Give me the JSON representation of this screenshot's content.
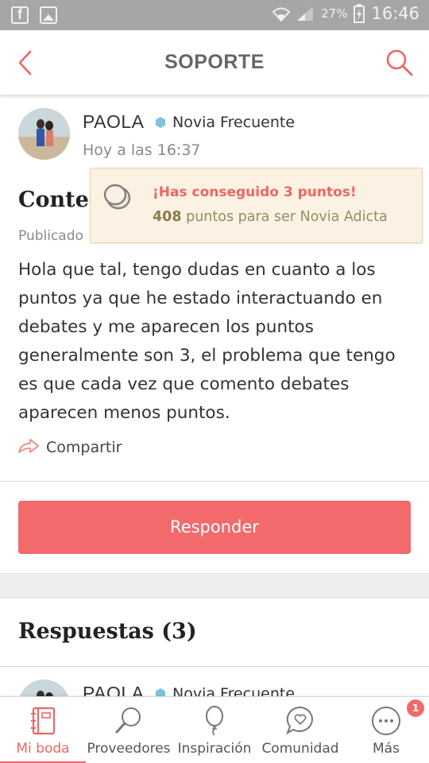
{
  "status_bar": {
    "battery": "27%",
    "time": "16:46"
  },
  "header": {
    "title": "SOPORTE"
  },
  "post": {
    "author": {
      "name": "PAOLA",
      "level": "Novia Frecuente",
      "time": "Hoy a las 16:37"
    },
    "title_visible": "Conteo",
    "meta_visible": "Publicado",
    "body": "Hola que tal, tengo dudas en cuanto a los puntos ya que he estado interactuando en debates y me aparecen los puntos generalmente son 3, el problema que tengo es que cada vez que comento debates aparecen menos puntos.",
    "share_label": "Compartir"
  },
  "toast": {
    "headline": "¡Has conseguido 3 puntos!",
    "points": "408",
    "points_text": " puntos para ser Novia Adicta"
  },
  "respond_label": "Responder",
  "answers": {
    "title": "Respuestas (3)",
    "first": {
      "name": "PAOLA",
      "level": "Novia Frecuente"
    }
  },
  "bottom_nav": {
    "items": [
      {
        "label": "Mi boda",
        "icon": "planner-icon",
        "active": true
      },
      {
        "label": "Proveedores",
        "icon": "search-icon"
      },
      {
        "label": "Inspiración",
        "icon": "balloon-icon"
      },
      {
        "label": "Comunidad",
        "icon": "chat-heart-icon"
      },
      {
        "label": "Más",
        "icon": "more-icon",
        "badge": "1"
      }
    ]
  },
  "colors": {
    "accent": "#f26a6c",
    "toast_bg": "#fbf2e4",
    "level_hex": "#7fc3dc"
  }
}
